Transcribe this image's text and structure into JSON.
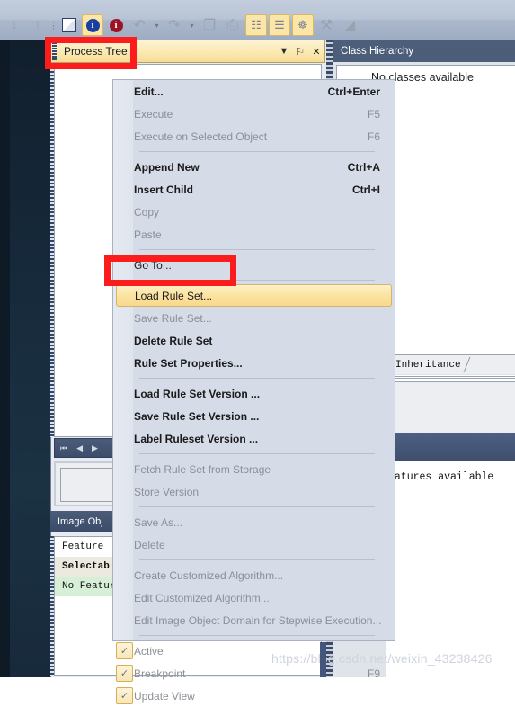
{
  "toolbar": {
    "items": [
      {
        "name": "arrow-down-icon",
        "glyph": "↓",
        "kind": "gray"
      },
      {
        "name": "arrow-up-icon",
        "glyph": "↑",
        "kind": "gray"
      },
      {
        "name": "toolbar-grip",
        "glyph": "⋮",
        "kind": "sep"
      },
      {
        "name": "new-document-icon",
        "glyph": "",
        "kind": "square"
      },
      {
        "name": "info-blue-icon",
        "glyph": "i",
        "kind": "info-blue"
      },
      {
        "name": "info-red-icon",
        "glyph": "i",
        "kind": "info-red"
      },
      {
        "name": "undo-icon",
        "glyph": "↶",
        "kind": "gray"
      },
      {
        "name": "undo-dropdown-icon",
        "glyph": "▾",
        "kind": "caret"
      },
      {
        "name": "redo-icon",
        "glyph": "↷",
        "kind": "gray"
      },
      {
        "name": "redo-dropdown-icon",
        "glyph": "▾",
        "kind": "caret"
      },
      {
        "name": "copy-icon",
        "glyph": "❐",
        "kind": "gray"
      },
      {
        "name": "paste-icon",
        "glyph": "⎙",
        "kind": "gray"
      },
      {
        "name": "process-tree-icon",
        "glyph": "☷",
        "kind": "hl"
      },
      {
        "name": "class-hierarchy-icon",
        "glyph": "☰",
        "kind": "hl"
      },
      {
        "name": "view-settings-icon",
        "glyph": "☸",
        "kind": "hl"
      },
      {
        "name": "tools-icon",
        "glyph": "⚒",
        "kind": "gray"
      },
      {
        "name": "measure-icon",
        "glyph": "◢",
        "kind": "gray"
      }
    ]
  },
  "process_tree_panel": {
    "title": "Process Tree",
    "dropdown_glyph": "▼",
    "pin_glyph": "⚐",
    "close_glyph": "✕",
    "nav": [
      "⏮",
      "◀",
      "▶"
    ]
  },
  "image_object_panel": {
    "title": "Image Obj",
    "rows": [
      "Feature",
      "Selectab",
      "No Featur"
    ]
  },
  "class_hierarchy_panel": {
    "title": "Class Hierarchy",
    "dots": "……",
    "empty_message": "No classes available"
  },
  "inheritance_panel": {
    "tab_label": "Inheritance"
  },
  "features_panel": {
    "empty_message": "eatures available"
  },
  "context_menu": {
    "groups": [
      {
        "items": [
          {
            "label": "Edit...",
            "accel": "Ctrl+Enter",
            "state": "bold",
            "name": "menu-item-edit"
          },
          {
            "label": "Execute",
            "accel": "F5",
            "state": "dim",
            "name": "menu-item-execute"
          },
          {
            "label": "Execute on Selected Object",
            "accel": "F6",
            "state": "dim",
            "name": "menu-item-execute-on-selected-object"
          }
        ]
      },
      {
        "items": [
          {
            "label": "Append New",
            "accel": "Ctrl+A",
            "state": "bold",
            "name": "menu-item-append-new"
          },
          {
            "label": "Insert Child",
            "accel": "Ctrl+I",
            "state": "bold",
            "name": "menu-item-insert-child"
          },
          {
            "label": "Copy",
            "accel": "",
            "state": "dim",
            "name": "menu-item-copy"
          },
          {
            "label": "Paste",
            "accel": "",
            "state": "dim",
            "name": "menu-item-paste"
          }
        ]
      },
      {
        "items": [
          {
            "label": "Go To...",
            "accel": "",
            "state": "normal",
            "name": "menu-item-go-to"
          }
        ]
      },
      {
        "items": [
          {
            "label": "Load Rule Set...",
            "accel": "",
            "state": "selected",
            "name": "menu-item-load-rule-set"
          },
          {
            "label": "Save Rule Set...",
            "accel": "",
            "state": "dim",
            "name": "menu-item-save-rule-set"
          },
          {
            "label": "Delete Rule Set",
            "accel": "",
            "state": "bold",
            "name": "menu-item-delete-rule-set"
          },
          {
            "label": "Rule Set Properties...",
            "accel": "",
            "state": "bold",
            "name": "menu-item-rule-set-properties"
          }
        ]
      },
      {
        "items": [
          {
            "label": "Load Rule Set Version ...",
            "accel": "",
            "state": "bold",
            "name": "menu-item-load-rule-set-version"
          },
          {
            "label": "Save Rule Set Version ...",
            "accel": "",
            "state": "bold",
            "name": "menu-item-save-rule-set-version"
          },
          {
            "label": "Label Ruleset Version ...",
            "accel": "",
            "state": "bold",
            "name": "menu-item-label-ruleset-version"
          }
        ]
      },
      {
        "items": [
          {
            "label": "Fetch Rule Set from Storage",
            "accel": "",
            "state": "dim",
            "name": "menu-item-fetch-rule-set-from-storage"
          },
          {
            "label": "Store Version",
            "accel": "",
            "state": "dim",
            "name": "menu-item-store-version"
          }
        ]
      },
      {
        "items": [
          {
            "label": "Save As...",
            "accel": "",
            "state": "dim",
            "name": "menu-item-save-as"
          },
          {
            "label": "Delete",
            "accel": "",
            "state": "dim",
            "name": "menu-item-delete"
          }
        ]
      },
      {
        "items": [
          {
            "label": "Create Customized Algorithm...",
            "accel": "",
            "state": "dim",
            "name": "menu-item-create-customized-algorithm"
          },
          {
            "label": "Edit Customized Algorithm...",
            "accel": "",
            "state": "dim",
            "name": "menu-item-edit-customized-algorithm"
          },
          {
            "label": "Edit Image Object Domain for Stepwise Execution...",
            "accel": "",
            "state": "dim",
            "name": "menu-item-edit-image-object-domain"
          }
        ]
      },
      {
        "items": [
          {
            "label": "Active",
            "accel": "",
            "state": "dim",
            "checked": true,
            "name": "menu-item-active"
          },
          {
            "label": "Breakpoint",
            "accel": "F9",
            "state": "dim",
            "checked": true,
            "name": "menu-item-breakpoint"
          },
          {
            "label": "Update View",
            "accel": "",
            "state": "dim",
            "checked": true,
            "name": "menu-item-update-view"
          }
        ]
      }
    ],
    "check_glyph": "✓"
  },
  "annotations": {
    "accent_color": "#fc1c1c",
    "boxes": [
      "process-tree-tab",
      "load-rule-set-item"
    ]
  },
  "watermark": {
    "text": "https://blog.csdn.net/weixin_43238426"
  }
}
